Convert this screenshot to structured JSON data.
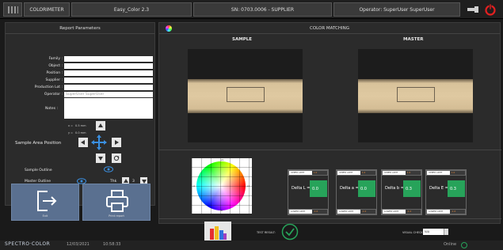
{
  "topbar": {
    "app_name": "COLORIMETER",
    "recipe": "Easy_Color 2.3",
    "serial": "SN: 0703.0006 - SUPPLIER",
    "operator": "Operator: SuperUser SuperUser"
  },
  "report": {
    "title": "Report Parameters",
    "fields": [
      {
        "label": "Family :",
        "value": ""
      },
      {
        "label": "Object :",
        "value": ""
      },
      {
        "label": "Position :",
        "value": ""
      },
      {
        "label": "Supplier :",
        "value": ""
      },
      {
        "label": "Production Lot :",
        "value": ""
      },
      {
        "label": "Operator :",
        "value": "SuperUser SuperUser"
      }
    ],
    "notes_label": "Notes :",
    "x_label": "x =",
    "x_value": "0.5 mm",
    "y_label": "y =",
    "y_value": "0.0 mm",
    "sample_area_label": "Sample Area Position",
    "sample_outline_label": "Sample Outline",
    "master_outline_label": "Master Outline",
    "thickness_label": "Thk",
    "thickness_value": "3",
    "exit_label": "Exit",
    "print_label": "Print report"
  },
  "color_matching": {
    "title": "COLOR MATCHING",
    "sample_title": "SAMPLE",
    "master_title": "MASTER",
    "wheel_labels": {
      "top": "+b",
      "left": "-a",
      "right": "+a",
      "bottom": "-b"
    },
    "deltas": [
      {
        "label": "Delta L =",
        "value": "0.0",
        "upper": "UPPER LIMIT",
        "upper_val": "1.0",
        "lower": "LOWER LIMIT",
        "lower_val": "-1.0"
      },
      {
        "label": "Delta a =",
        "value": "0.0",
        "upper": "UPPER LIMIT",
        "upper_val": "1.0",
        "lower": "LOWER LIMIT",
        "lower_val": "-1.0"
      },
      {
        "label": "Delta b =",
        "value": "0.3",
        "upper": "UPPER LIMIT",
        "upper_val": "1.0",
        "lower": "LOWER LIMIT",
        "lower_val": "-1.0"
      },
      {
        "label": "Delta E =",
        "value": "0.3",
        "upper": "UPPER LIMIT",
        "upper_val": "1.0",
        "lower": "LOWER LIMIT",
        "lower_val": "-1.0"
      }
    ],
    "test_result_label": "TEST RESULT:",
    "visual_check_label": "VISUAL CHECK:",
    "visual_check_value": "N/A"
  },
  "status": {
    "brand": "SPECTRO·COLOR",
    "date": "12/03/2021",
    "time": "10:58:33",
    "online": "Online"
  },
  "colors": {
    "accent_green": "#27a35a",
    "button_blue": "#5a7090",
    "power_red": "#e32020"
  }
}
